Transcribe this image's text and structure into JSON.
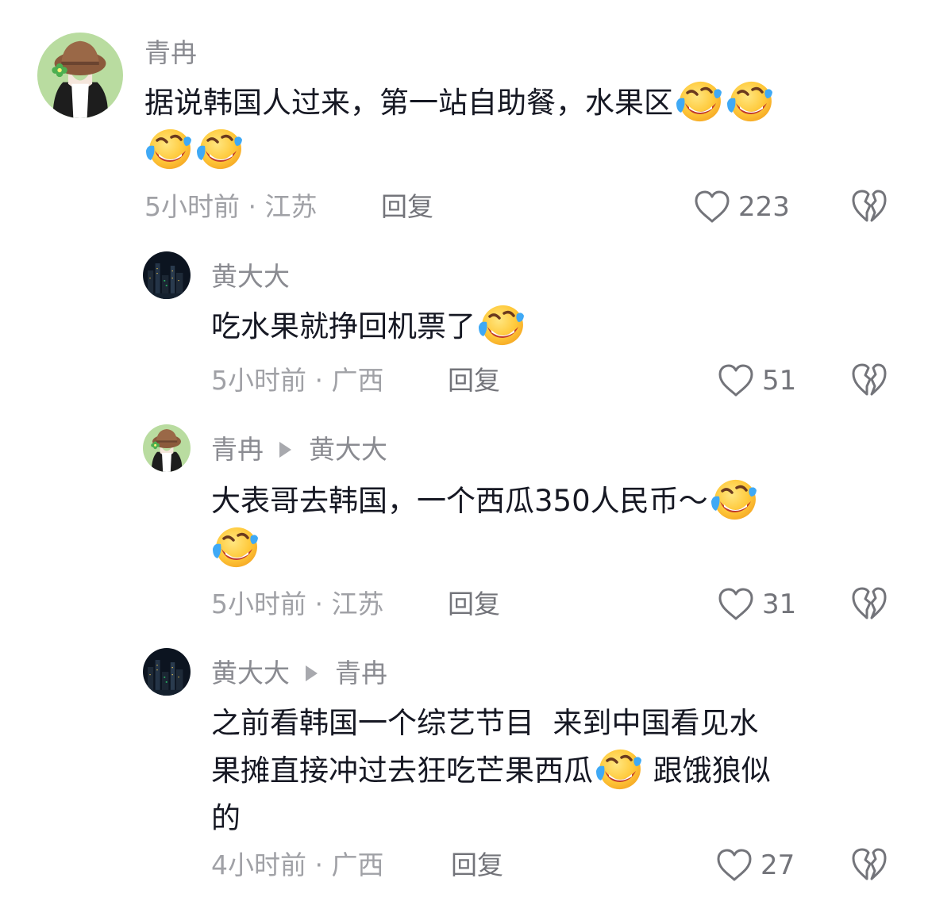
{
  "comments": [
    {
      "author": "青冉",
      "reply_to": "",
      "text_line1": "据说韩国人过来，第一站自助餐，水果区",
      "text_line2": "",
      "text_tail": "",
      "emoji_name": "laughing-crying-emoji",
      "meta": "5小时前 · 江苏",
      "reply_label": "回复",
      "likes": "223"
    },
    {
      "author": "黄大大",
      "reply_to": "",
      "text_line1": "吃水果就挣回机票了",
      "meta": "5小时前 · 广西",
      "reply_label": "回复",
      "likes": "51"
    },
    {
      "author": "青冉",
      "reply_to": "黄大大",
      "text_line1": "大表哥去韩国，一个西瓜350人民币～",
      "meta": "5小时前 · 江苏",
      "reply_label": "回复",
      "likes": "31"
    },
    {
      "author": "黄大大",
      "reply_to": "青冉",
      "text_line1": "之前看韩国一个综艺节目  来到中国看见水",
      "text_line2": "果摊直接冲过去狂吃芒果西瓜",
      "text_line2_tail": " 跟饿狼似",
      "text_line3": "的",
      "meta": "4小时前 · 广西",
      "reply_label": "回复",
      "likes": "27"
    }
  ],
  "icons": {
    "like": "heart-outline-icon",
    "dislike": "broken-heart-icon",
    "reply_arrow": "play-triangle-icon"
  },
  "colors": {
    "text": "#161823",
    "meta": "#a0a1a6",
    "name": "#8a8b91",
    "action": "#73747a",
    "avatar_green_bg": "#b9dca0"
  }
}
